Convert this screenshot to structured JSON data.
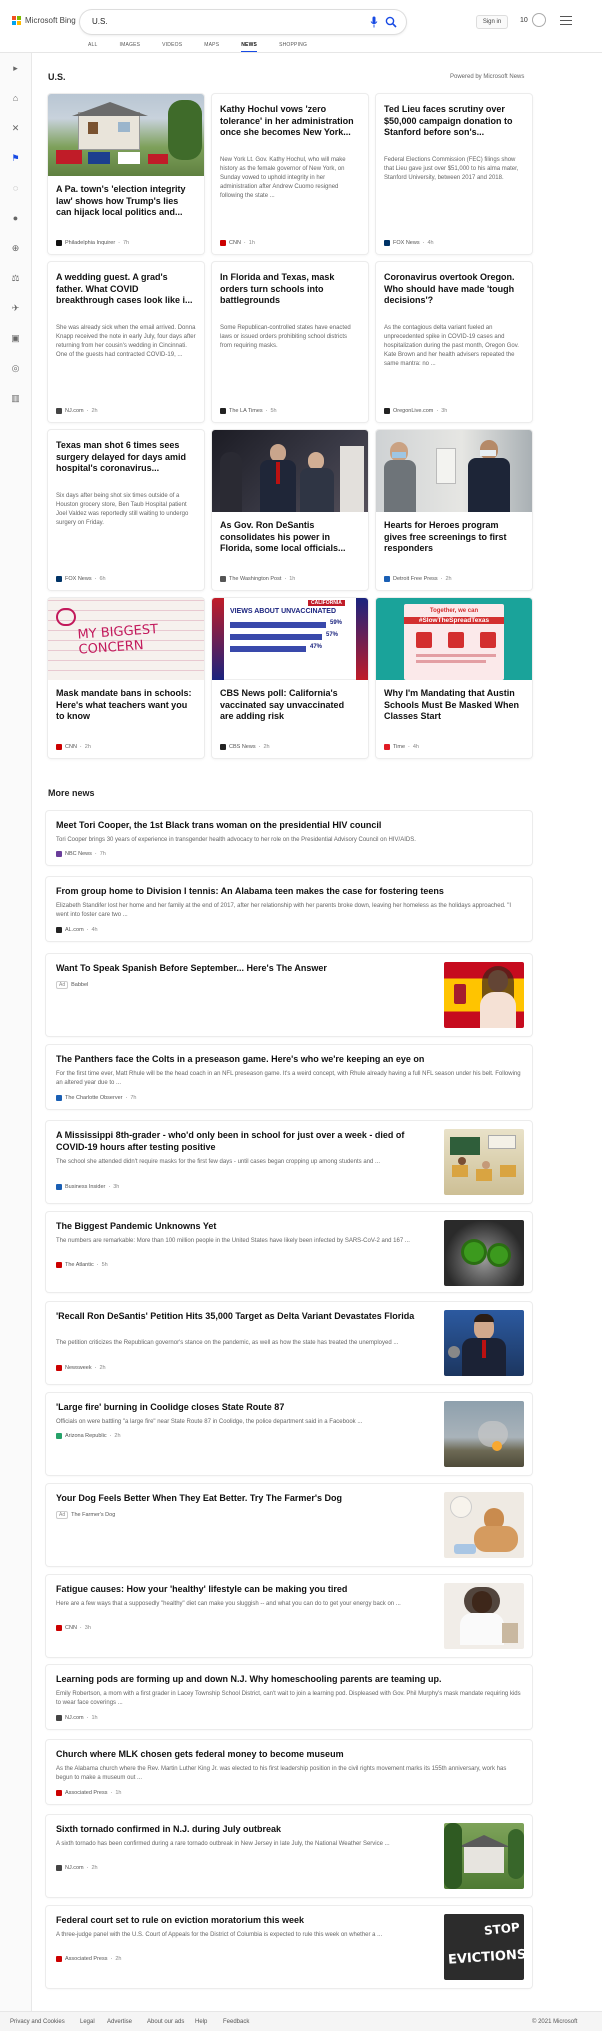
{
  "header": {
    "brand": "Microsoft Bing",
    "query": "U.S.",
    "sign_in": "Sign in",
    "rewards_count": "10",
    "tabs": [
      {
        "label": "ALL"
      },
      {
        "label": "IMAGES"
      },
      {
        "label": "VIDEOS"
      },
      {
        "label": "MAPS"
      },
      {
        "label": "NEWS",
        "active": true
      },
      {
        "label": "SHOPPING"
      }
    ]
  },
  "section": {
    "title": "U.S.",
    "powered_by": "Powered by Microsoft News"
  },
  "top_cards": [
    {
      "title": "A Pa. town's 'election integrity law' shows how Trump's lies can hijack local politics and...",
      "summary": "",
      "source": "Philadelphia Inquirer",
      "time": "7h",
      "image": "house-with-signs",
      "fav_color": "#111"
    },
    {
      "title": "Kathy Hochul vows 'zero tolerance' in her administration once she becomes New York...",
      "summary": "New York Lt. Gov. Kathy Hochul, who will make history as the female governor of New York, on Sunday vowed to uphold integrity in her administration after Andrew Cuomo resigned following the state ...",
      "source": "CNN",
      "time": "1h",
      "image": "",
      "fav_color": "#cc0000"
    },
    {
      "title": "Ted Lieu faces scrutiny over $50,000 campaign donation to Stanford before son's...",
      "summary": "Federal Elections Commission (FEC) filings show that Lieu gave just over $51,000 to his alma mater, Stanford University, between 2017 and 2018.",
      "source": "FOX News",
      "time": "4h",
      "image": "",
      "fav_color": "#003366"
    },
    {
      "title": "A wedding guest. A grad's father. What COVID breakthrough cases look like i...",
      "summary": "She was already sick when the email arrived. Donna Knapp received the note in early July, four days after returning from her cousin's wedding in Cincinnati. One of the guests had contracted COVID-19, ...",
      "source": "NJ.com",
      "time": "2h",
      "image": "",
      "fav_color": "#444"
    },
    {
      "title": "In Florida and Texas, mask orders turn schools into battlegrounds",
      "summary": "Some Republican-controlled states have enacted laws or issued orders prohibiting school districts from requiring masks.",
      "source": "The LA Times",
      "time": "5h",
      "image": "",
      "fav_color": "#222"
    },
    {
      "title": "Coronavirus overtook Oregon. Who should have made 'tough decisions'?",
      "summary": "As the contagious delta variant fueled an unprecedented spike in COVID-19 cases and hospitalization during the past month, Oregon Gov. Kate Brown and her health advisers repeated the same mantra: no ...",
      "source": "OregonLive.com",
      "time": "3h",
      "image": "",
      "fav_color": "#222"
    },
    {
      "title": "Texas man shot 6 times sees surgery delayed for days amid hospital's coronavirus...",
      "summary": "Six days after being shot six times outside of a Houston grocery store, Ben Taub Hospital patient Joel Valdez was reportedly still waiting to undergo surgery on Friday.",
      "source": "FOX News",
      "time": "6h",
      "image": "",
      "fav_color": "#003366"
    },
    {
      "title": "As Gov. Ron DeSantis consolidates his power in Florida, some local officials...",
      "summary": "",
      "source": "The Washington Post",
      "time": "1h",
      "image": "desantis-press",
      "fav_color": "#555"
    },
    {
      "title": "Hearts for Heroes program gives free screenings to first responders",
      "summary": "",
      "source": "Detroit Free Press",
      "time": "2h",
      "image": "officer-clinic",
      "fav_color": "#1a5fb4"
    },
    {
      "title": "Mask mandate bans in schools: Here's what teachers want you to know",
      "summary": "",
      "source": "CNN",
      "time": "2h",
      "image": "my-biggest-concern",
      "fav_color": "#cc0000"
    },
    {
      "title": "CBS News poll: California's vaccinated say unvaccinated are adding risk",
      "summary": "",
      "source": "CBS News",
      "time": "2h",
      "image": "california-poll",
      "fav_color": "#222"
    },
    {
      "title": "Why I'm Mandating that Austin Schools Must Be Masked When Classes Start",
      "summary": "",
      "source": "Time",
      "time": "4h",
      "image": "slow-the-spread",
      "fav_color": "#e01b24"
    }
  ],
  "poll_graphic": {
    "brand": "CALIFORNIA",
    "headline": "VIEWS ABOUT UNVACCINATED",
    "percents": [
      "59%",
      "57%",
      "47%"
    ]
  },
  "sign_graphic": {
    "line1": "Together, we can",
    "line2": "#SlowTheSpreadTexas"
  },
  "concern_graphic": {
    "text": "MY BIGGEST CONCERN"
  },
  "more_news_title": "More news",
  "more_news": [
    {
      "title": "Meet Tori Cooper, the 1st Black trans woman on the presidential HIV council",
      "summary": "Tori Cooper brings 30 years of experience in transgender health advocacy to her role on the Presidential Advisory Council on HIV/AIDS.",
      "source": "NBC News",
      "time": "7h",
      "ad": false,
      "thumb": "",
      "fav_color": "#6a3d9a"
    },
    {
      "title": "From group home to Division I tennis: An Alabama teen makes the case for fostering teens",
      "summary": "Elizabeth Standifer lost her home and her family at the end of 2017, after her relationship with her parents broke down, leaving her homeless as the holidays approached. \"I went into foster care two ...",
      "source": "AL.com",
      "time": "4h",
      "ad": false,
      "thumb": "",
      "fav_color": "#222"
    },
    {
      "title": "Want To Speak Spanish Before September... Here's The Answer",
      "summary": "",
      "source": "Babbel",
      "time": "",
      "ad": true,
      "ad_label": "Ad",
      "thumb": "spain-flag",
      "fav_color": ""
    },
    {
      "title": "The Panthers face the Colts in a preseason game. Here's who we're keeping an eye on",
      "summary": "For the first time ever, Matt Rhule will be the head coach in an NFL preseason game. It's a weird concept, with Rhule already having a full NFL season under his belt. Following an altered year due to ...",
      "source": "The Charlotte Observer",
      "time": "7h",
      "ad": false,
      "thumb": "",
      "fav_color": "#1a5fb4"
    },
    {
      "title": "A Mississippi 8th-grader - who'd only been in school for just over a week - died of COVID-19 hours after testing positive",
      "summary": "The school she attended didn't require masks for the first few days - until cases began cropping up among students and ...",
      "source": "Business Insider",
      "time": "3h",
      "ad": false,
      "thumb": "classroom",
      "fav_color": "#1a5fb4"
    },
    {
      "title": "The Biggest Pandemic Unknowns Yet",
      "summary": "The numbers are remarkable: More than 100 million people in the United States have likely been infected by SARS-CoV-2 and 167 ...",
      "source": "The Atlantic",
      "time": "5h",
      "ad": false,
      "thumb": "virus",
      "fav_color": "#cc0000"
    },
    {
      "title": "'Recall Ron DeSantis' Petition Hits 35,000 Target as Delta Variant Devastates Florida",
      "summary": "The petition criticizes the Republican governor's stance on the pandemic, as well as how the state has treated the unemployed ...",
      "source": "Newsweek",
      "time": "2h",
      "ad": false,
      "thumb": "desantis",
      "fav_color": "#cc0000"
    },
    {
      "title": "'Large fire' burning in Coolidge closes State Route 87",
      "summary": "Officials on were battling \"a large fire\" near State Route 87 in Coolidge, the police department said in a Facebook ...",
      "source": "Arizona Republic",
      "time": "2h",
      "ad": false,
      "thumb": "fire",
      "fav_color": "#26a269"
    },
    {
      "title": "Your Dog Feels Better When They Eat Better. Try The Farmer's Dog",
      "summary": "",
      "source": "The Farmer's Dog",
      "time": "",
      "ad": true,
      "ad_label": "Ad",
      "thumb": "dog",
      "fav_color": ""
    },
    {
      "title": "Fatigue causes: How your 'healthy' lifestyle can be making you tired",
      "summary": "Here are a few ways that a supposedly \"healthy\" diet can make you sluggish -- and what you can do to get your energy back on ...",
      "source": "CNN",
      "time": "3h",
      "ad": false,
      "thumb": "tired-woman",
      "fav_color": "#cc0000"
    },
    {
      "title": "Learning pods are forming up and down N.J. Why homeschooling parents are teaming up.",
      "summary": "Emily Robertson, a mom with a first grader in Lacey Township School District, can't wait to join a learning pod. Displeased with Gov. Phil Murphy's mask mandate requiring kids to wear face coverings ...",
      "source": "NJ.com",
      "time": "1h",
      "ad": false,
      "thumb": "",
      "fav_color": "#444"
    },
    {
      "title": "Church where MLK chosen gets federal money to become museum",
      "summary": "As the Alabama church where the Rev. Martin Luther King Jr. was elected to his first leadership position in the civil rights movement marks its 155th anniversary, work has begun to make a museum out ...",
      "source": "Associated Press",
      "time": "1h",
      "ad": false,
      "thumb": "",
      "fav_color": "#cc0000"
    },
    {
      "title": "Sixth tornado confirmed in N.J. during July outbreak",
      "summary": "A sixth tornado has been confirmed during a rare tornado outbreak in New Jersey in late July, the National Weather Service ...",
      "source": "NJ.com",
      "time": "2h",
      "ad": false,
      "thumb": "house",
      "fav_color": "#444"
    },
    {
      "title": "Federal court set to rule on eviction moratorium this week",
      "summary": "A three-judge panel with the U.S. Court of Appeals for the District of Columbia is expected to rule this week on whether a ...",
      "source": "Associated Press",
      "time": "2h",
      "ad": false,
      "thumb": "evictions",
      "fav_color": "#cc0000"
    }
  ],
  "evictions_sign": {
    "line1": "STOP",
    "line2": "EVICTIONS"
  },
  "footer": {
    "links": [
      "Privacy and Cookies",
      "Legal",
      "Advertise",
      "About our ads",
      "Help",
      "Feedback"
    ],
    "copyright": "© 2021 Microsoft"
  }
}
